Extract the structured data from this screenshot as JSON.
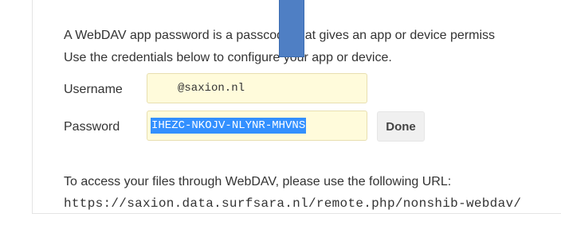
{
  "intro": {
    "line1": "A WebDAV app password is a passcode that gives an app or device permiss",
    "line2": "Use the credentials below to configure your app or device."
  },
  "credentials": {
    "username_label": "Username",
    "username_value": "@saxion.nl",
    "password_label": "Password",
    "password_value": "IHEZC-NKOJV-NLYNR-MHVNS",
    "done_label": "Done"
  },
  "footer": {
    "webdav_text": "To access your files through WebDAV, please use the following URL:",
    "webdav_url": "https://saxion.data.surfsara.nl/remote.php/nonshib-webdav/"
  },
  "colors": {
    "field_bg": "#fffbdb",
    "selection": "#3390ff",
    "marker": "#4f7fc4"
  }
}
